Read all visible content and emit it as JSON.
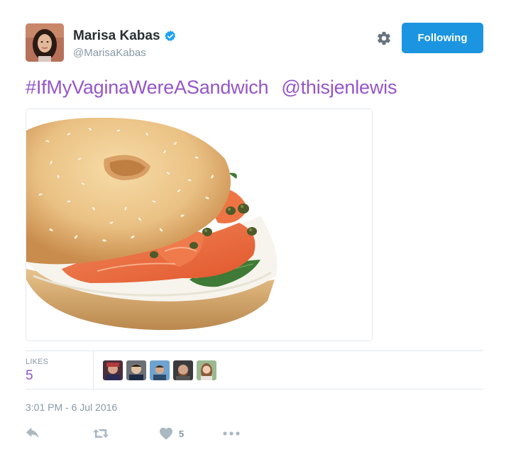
{
  "author": {
    "display_name": "Marisa Kabas",
    "handle": "@MarisaKabas",
    "verified": true
  },
  "follow_button": {
    "label": "Following"
  },
  "tweet": {
    "hashtag": "#IfMyVaginaWereASandwich",
    "mention": "@thisjenlewis",
    "media_description": "bagel-with-lox-image"
  },
  "stats": {
    "likes_label": "LIKES",
    "likes_count": "5",
    "likers_count": 5
  },
  "timestamp": "3:01 PM - 6 Jul 2016",
  "actions": {
    "reply_icon": "reply-icon",
    "retweet_icon": "retweet-icon",
    "like_icon": "heart-icon",
    "like_count": "5",
    "more_icon": "more-icon"
  },
  "colors": {
    "link": "#9456c8",
    "follow_button_bg": "#1b95e0",
    "muted": "#8899a6",
    "verified": "#1da1f2"
  }
}
